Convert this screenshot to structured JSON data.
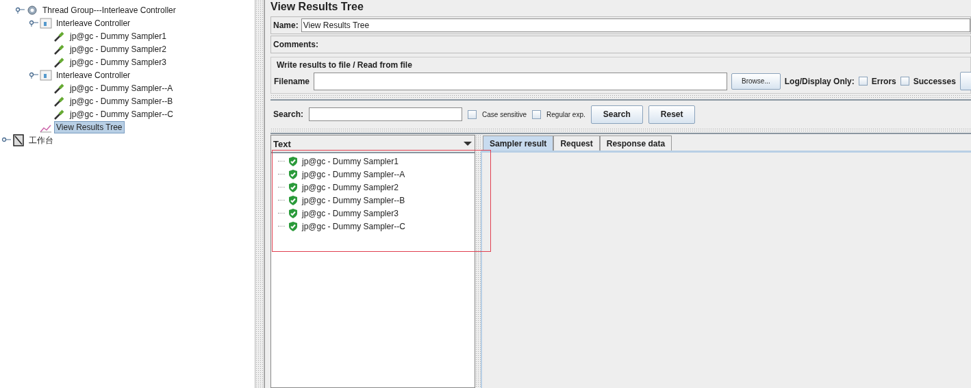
{
  "tree": {
    "children": [
      {
        "label": "Thread Group---Interleave Controller",
        "kind": "thread-group",
        "expanded": true,
        "selected": false,
        "children": [
          {
            "label": "Interleave Controller",
            "kind": "controller",
            "expanded": true,
            "selected": false,
            "children": [
              {
                "label": "jp@gc - Dummy Sampler1",
                "kind": "sampler",
                "selected": false
              },
              {
                "label": "jp@gc - Dummy Sampler2",
                "kind": "sampler",
                "selected": false
              },
              {
                "label": "jp@gc - Dummy Sampler3",
                "kind": "sampler",
                "selected": false
              }
            ]
          },
          {
            "label": "Interleave Controller",
            "kind": "controller",
            "expanded": true,
            "selected": false,
            "children": [
              {
                "label": "jp@gc - Dummy Sampler--A",
                "kind": "sampler",
                "selected": false
              },
              {
                "label": "jp@gc - Dummy Sampler--B",
                "kind": "sampler",
                "selected": false
              },
              {
                "label": "jp@gc - Dummy Sampler--C",
                "kind": "sampler",
                "selected": false
              }
            ]
          },
          {
            "label": "View Results Tree",
            "kind": "listener",
            "selected": true
          }
        ]
      }
    ]
  },
  "workbench": {
    "label": "工作台",
    "kind": "workbench",
    "expanded": false,
    "selected": false
  },
  "panel": {
    "title": "View Results Tree",
    "name_label": "Name:",
    "name_value": "View Results Tree",
    "comments_label": "Comments:",
    "file_group": {
      "title": "Write results to file / Read from file",
      "filename_label": "Filename",
      "browse": "Browse...",
      "log_label": "Log/Display Only:",
      "options": [
        {
          "label": "Errors",
          "checked": false
        },
        {
          "label": "Successes",
          "checked": false
        }
      ]
    },
    "search": {
      "label": "Search:",
      "options": [
        {
          "label": "Case sensitive",
          "checked": false
        },
        {
          "label": "Regular exp.",
          "checked": false
        }
      ],
      "buttons": [
        "Search",
        "Reset"
      ]
    },
    "results": {
      "renderer": "Text",
      "items": [
        {
          "label": "jp@gc - Dummy Sampler1",
          "kind": "success"
        },
        {
          "label": "jp@gc - Dummy Sampler--A",
          "kind": "success"
        },
        {
          "label": "jp@gc - Dummy Sampler2",
          "kind": "success"
        },
        {
          "label": "jp@gc - Dummy Sampler--B",
          "kind": "success"
        },
        {
          "label": "jp@gc - Dummy Sampler3",
          "kind": "success"
        },
        {
          "label": "jp@gc - Dummy Sampler--C",
          "kind": "success"
        }
      ]
    },
    "tabs": [
      {
        "label": "Sampler result",
        "selected": true
      },
      {
        "label": "Request",
        "selected": false
      },
      {
        "label": "Response data",
        "selected": false
      }
    ]
  }
}
